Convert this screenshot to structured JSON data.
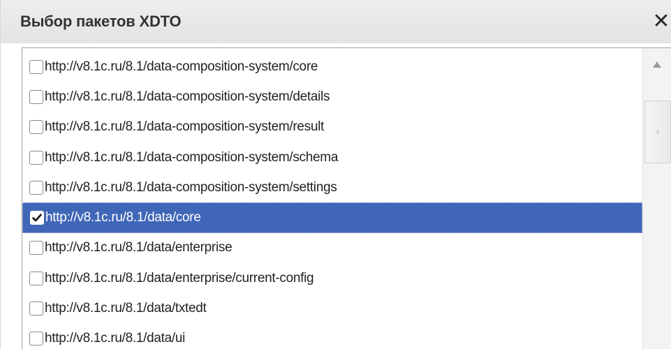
{
  "window": {
    "title": "Выбор пакетов XDTO",
    "close_glyph": "✕",
    "close_icon": "close-icon"
  },
  "colors": {
    "selection": "#4066b8",
    "title_bar": "#e8e8e8",
    "text": "#222222"
  },
  "packages": [
    {
      "label": "http://v8.1c.ru/8.1/data-composition-system/core",
      "checked": false,
      "selected": false
    },
    {
      "label": "http://v8.1c.ru/8.1/data-composition-system/details",
      "checked": false,
      "selected": false
    },
    {
      "label": "http://v8.1c.ru/8.1/data-composition-system/result",
      "checked": false,
      "selected": false
    },
    {
      "label": "http://v8.1c.ru/8.1/data-composition-system/schema",
      "checked": false,
      "selected": false
    },
    {
      "label": "http://v8.1c.ru/8.1/data-composition-system/settings",
      "checked": false,
      "selected": false
    },
    {
      "label": "http://v8.1c.ru/8.1/data/core",
      "checked": true,
      "selected": true
    },
    {
      "label": "http://v8.1c.ru/8.1/data/enterprise",
      "checked": false,
      "selected": false
    },
    {
      "label": "http://v8.1c.ru/8.1/data/enterprise/current-config",
      "checked": false,
      "selected": false
    },
    {
      "label": "http://v8.1c.ru/8.1/data/txtedt",
      "checked": false,
      "selected": false
    },
    {
      "label": "http://v8.1c.ru/8.1/data/ui",
      "checked": false,
      "selected": false
    }
  ],
  "scrollbar": {
    "up_icon": "scroll-up-arrow-icon",
    "grip_icon": "scroll-grip-icon"
  }
}
